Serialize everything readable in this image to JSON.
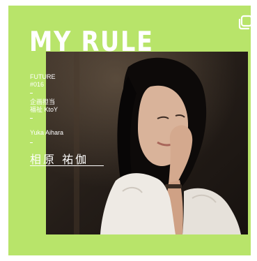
{
  "card": {
    "title": "MY RULE",
    "series": "FUTURE",
    "number": "#016",
    "role_line1": "企画担当",
    "role_line2": "福祉 KtoY",
    "name_romaji": "Yuka Aihara",
    "signature": "相原 祐伽"
  },
  "icons": {
    "corner": "multiple-pages-icon"
  },
  "colors": {
    "background": "#b8e46a",
    "text": "#ffffff",
    "photo_dark": "#2a231d"
  }
}
